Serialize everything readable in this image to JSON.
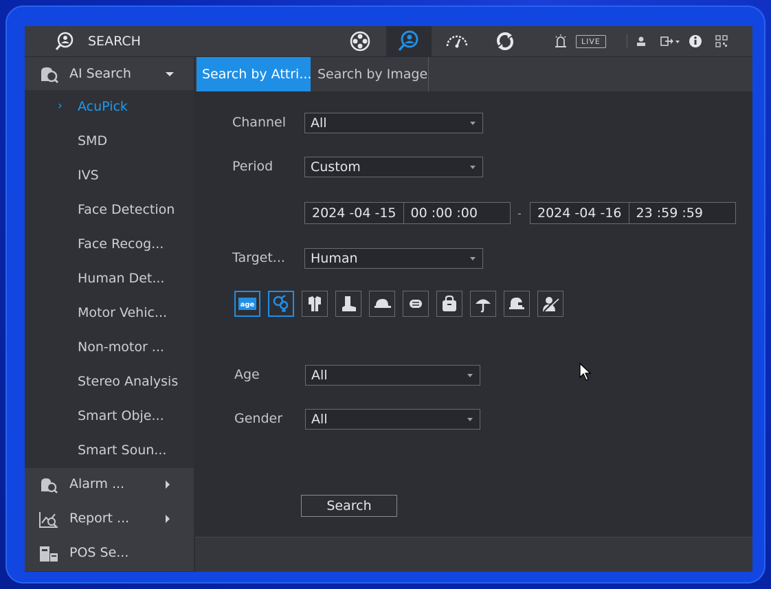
{
  "app": {
    "title": "SEARCH"
  },
  "topbar": {
    "live_label": "LIVE"
  },
  "icons": [
    "search-person-icon",
    "film-reel-icon",
    "ai-search-icon",
    "speedometer-icon",
    "sync-icon",
    "alarm-icon",
    "user-icon",
    "logout-icon",
    "info-icon",
    "qrcode-icon",
    "shield-icon",
    "umbrella-icon",
    "bag-icon",
    "mask-icon",
    "cap-icon",
    "boot-icon",
    "clothes-icon",
    "gender-icon",
    "age-icon",
    "no-person-icon",
    "helmet-icon"
  ],
  "colors": {
    "accent": "#1f8fe6",
    "active_text": "#1e9bf0",
    "bezel": "#1146e0"
  },
  "sidebar": {
    "header": "AI Search",
    "items": [
      {
        "label": "AcuPick",
        "active": true
      },
      {
        "label": "SMD"
      },
      {
        "label": "IVS"
      },
      {
        "label": "Face Detection"
      },
      {
        "label": "Face Recog..."
      },
      {
        "label": "Human Det..."
      },
      {
        "label": "Motor Vehic..."
      },
      {
        "label": "Non-motor ..."
      },
      {
        "label": "Stereo Analysis"
      },
      {
        "label": "Smart Obje..."
      },
      {
        "label": "Smart Soun..."
      }
    ],
    "sections": [
      {
        "label": "Alarm ..."
      },
      {
        "label": "Report ..."
      },
      {
        "label": "POS Se..."
      }
    ]
  },
  "tabs": [
    {
      "label": "Search by Attri...",
      "active": true
    },
    {
      "label": "Search by Image"
    }
  ],
  "form": {
    "channel_label": "Channel",
    "channel_value": "All",
    "period_label": "Period",
    "period_value": "Custom",
    "start_date": "2024 -04 -15",
    "start_time": "00 :00 :00",
    "end_date": "2024 -04 -16",
    "end_time": "23 :59 :59",
    "range_sep": "-",
    "target_label": "Target...",
    "target_value": "Human",
    "age_label": "Age",
    "age_value": "All",
    "gender_label": "Gender",
    "gender_value": "All",
    "search_button": "Search"
  }
}
